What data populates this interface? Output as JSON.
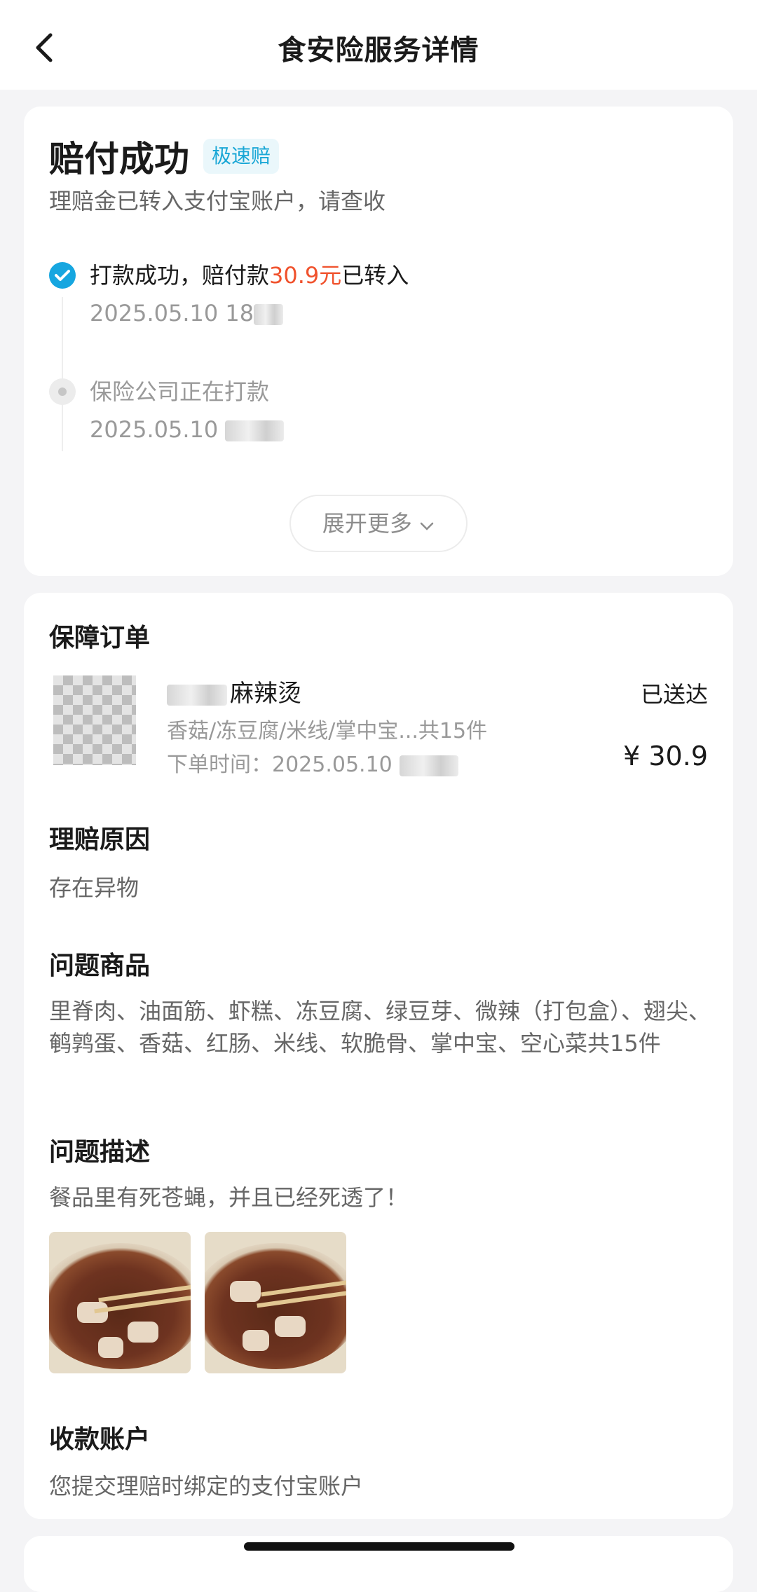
{
  "header": {
    "title": "食安险服务详情",
    "back_icon": "chevron-left-icon"
  },
  "status": {
    "title": "赔付成功",
    "badge": "极速赔",
    "subtitle": "理赔金已转入支付宝账户，请查收"
  },
  "timeline": [
    {
      "prefix": "打款成功，赔付款",
      "amount": "30.9元",
      "suffix": "已转入",
      "time": "2025.05.10 18",
      "state": "done"
    },
    {
      "text": "保险公司正在打款",
      "time": "2025.05.10",
      "state": "pending"
    }
  ],
  "expand_label": "展开更多",
  "order": {
    "section_title": "保障订单",
    "shop_name": "麻辣烫",
    "items": "香菇/冻豆腐/米线/掌中宝...共15件",
    "time_label": "下单时间：",
    "time": "2025.05.10",
    "delivery_status": "已送达",
    "price": "¥ 30.9"
  },
  "claim": {
    "reason_title": "理赔原因",
    "reason": "存在异物",
    "goods_title": "问题商品",
    "goods": "里脊肉、油面筋、虾糕、冻豆腐、绿豆芽、微辣（打包盒）、翅尖、鹌鹑蛋、香菇、红肠、米线、软脆骨、掌中宝、空心菜共15件",
    "desc_title": "问题描述",
    "desc": "餐品里有死苍蝇，并且已经死透了！",
    "account_title": "收款账户",
    "account": "您提交理赔时绑定的支付宝账户"
  },
  "colors": {
    "accent": "#16a6e0",
    "amount": "#f0522d",
    "badge_bg": "#eaf7fb"
  }
}
